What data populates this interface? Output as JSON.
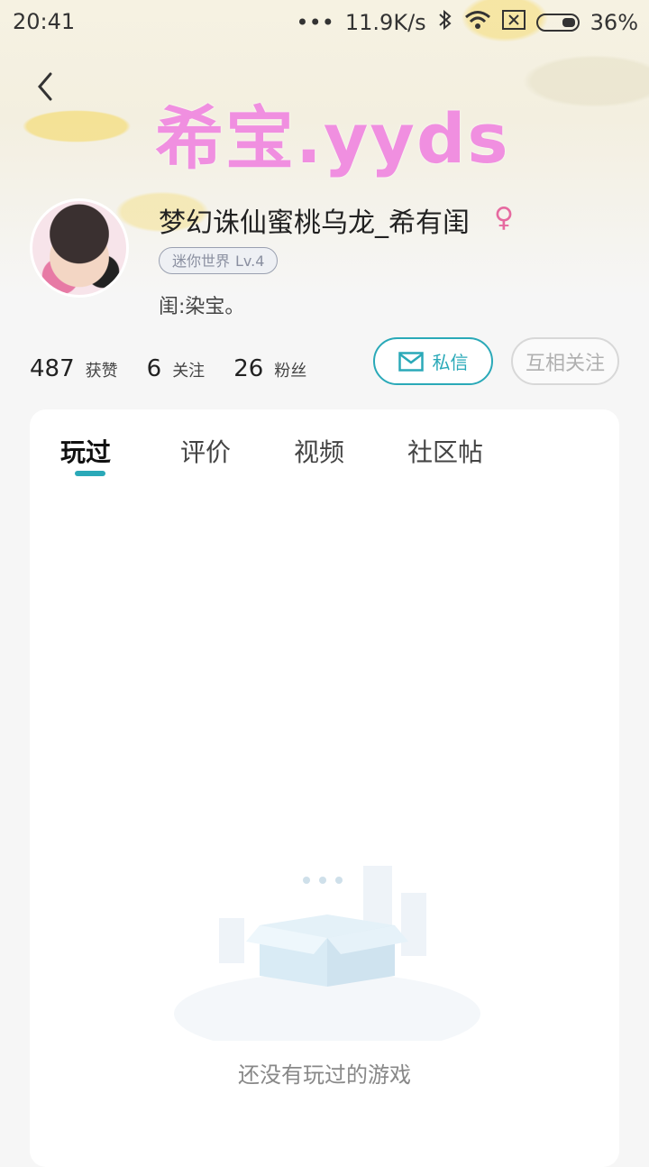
{
  "status_bar": {
    "time": "20:41",
    "dots": "•••",
    "net_speed": "11.9K/s",
    "battery": "36%"
  },
  "banner": {
    "title": "希宝.yyds"
  },
  "profile": {
    "name": "梦幻诛仙蜜桃乌龙_希有闺",
    "gender_symbol": "♀",
    "badge_game": "迷你世界",
    "badge_level": "Lv.4",
    "bio": "闺:染宝。"
  },
  "stats": [
    {
      "num": "487",
      "label": "获赞"
    },
    {
      "num": "6",
      "label": "关注"
    },
    {
      "num": "26",
      "label": "粉丝"
    }
  ],
  "buttons": {
    "message": "私信",
    "follow": "互相关注"
  },
  "tabs": [
    "玩过",
    "评价",
    "视频",
    "社区帖"
  ],
  "empty_state": "还没有玩过的游戏",
  "colors": {
    "accent": "#2aa9b8",
    "banner_text": "#f07fe0"
  }
}
